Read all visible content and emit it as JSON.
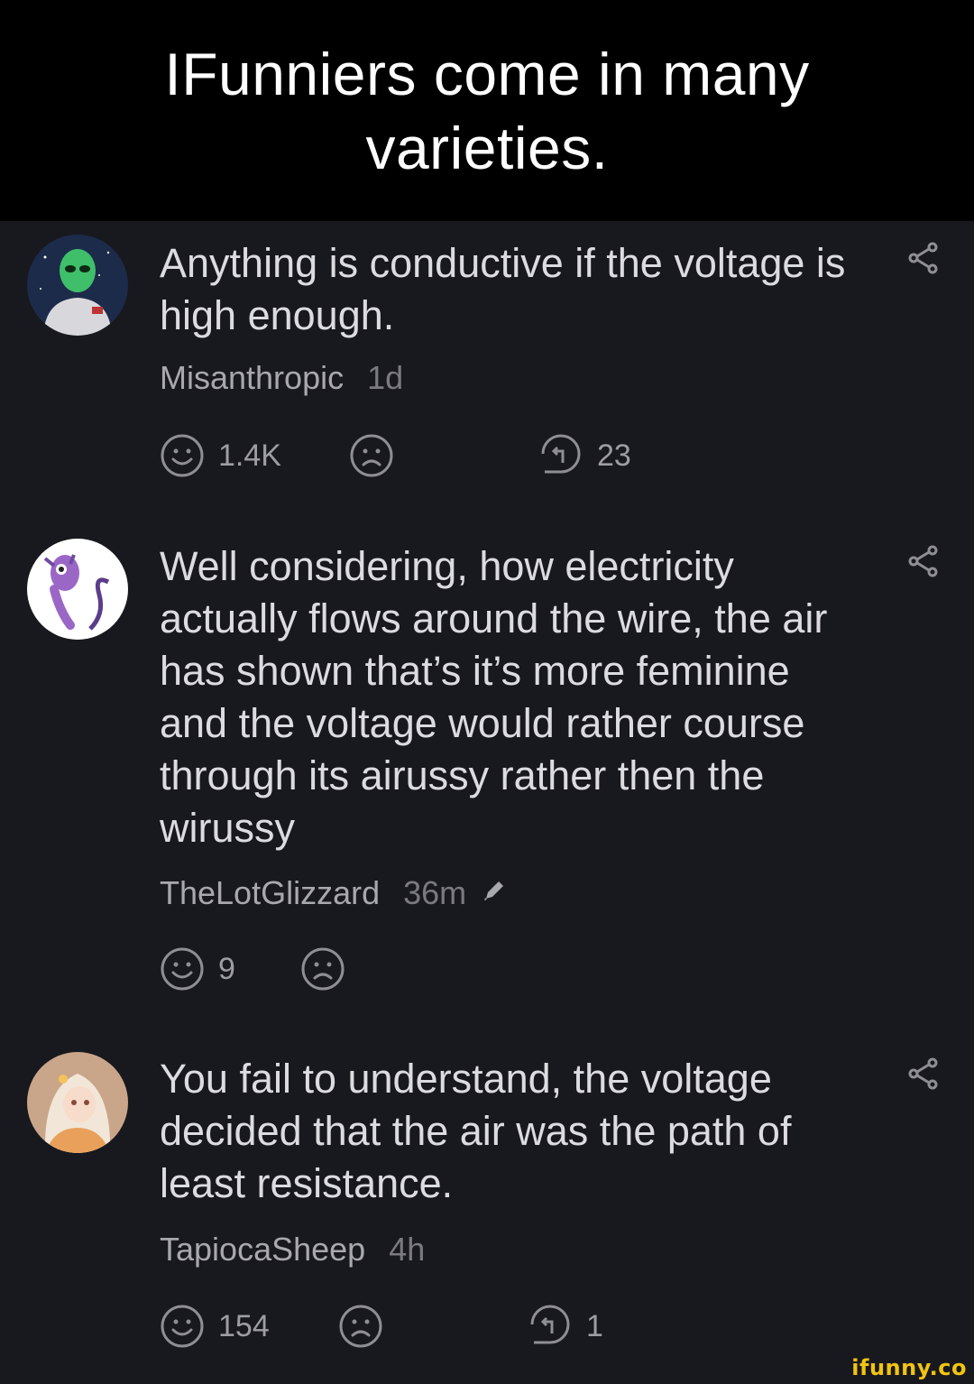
{
  "caption": "IFunniers come in many varieties.",
  "comments": [
    {
      "text": "Anything is conductive if the voltage is high enough.",
      "author": "Misanthropic",
      "time": "1d",
      "smiles": "1.4K",
      "replies": "23"
    },
    {
      "text": "Well considering, how electricity actually flows around the wire, the air has shown that’s it’s more feminine and the voltage would rather course through its airussy rather then the wirussy",
      "author": "TheLotGlizzard",
      "time": "36m",
      "smiles": "9"
    },
    {
      "text": "You fail to understand, the voltage decided that the air was the path of least resistance.",
      "author": "TapiocaSheep",
      "time": "4h",
      "smiles": "154",
      "replies": "1"
    }
  ],
  "watermark": "ifunny.co",
  "colors": {
    "background": "#18191e",
    "caption_bg": "#000000",
    "text": "#dcdce0",
    "meta": "#a8a8ae",
    "icon": "#8e8e94",
    "watermark": "#f2c40f"
  }
}
